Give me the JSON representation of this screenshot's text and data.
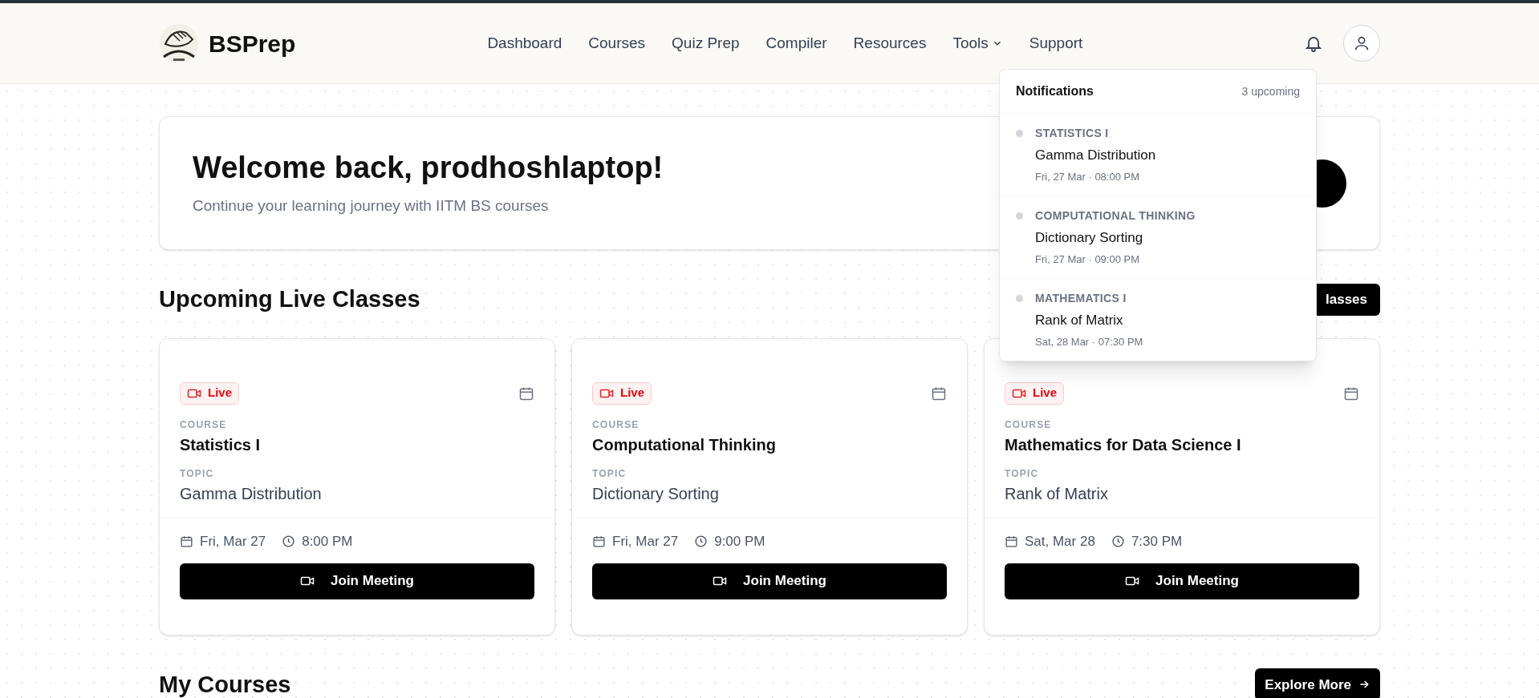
{
  "brand": {
    "name": "BSPrep"
  },
  "nav": [
    {
      "label": "Dashboard",
      "dropdown": false
    },
    {
      "label": "Courses",
      "dropdown": false
    },
    {
      "label": "Quiz Prep",
      "dropdown": false
    },
    {
      "label": "Compiler",
      "dropdown": false
    },
    {
      "label": "Resources",
      "dropdown": false
    },
    {
      "label": "Tools",
      "dropdown": true
    },
    {
      "label": "Support",
      "dropdown": false
    }
  ],
  "welcome": {
    "title": "Welcome back, prodhoshlaptop!",
    "subtitle": "Continue your learning journey with IITM BS courses"
  },
  "upcoming": {
    "title": "Upcoming Live Classes",
    "button": "lasses",
    "cards": [
      {
        "badge": "Live",
        "course_label": "COURSE",
        "course": "Statistics I",
        "topic_label": "TOPIC",
        "topic": "Gamma Distribution",
        "date": "Fri, Mar 27",
        "time": "8:00 PM",
        "button": "Join Meeting"
      },
      {
        "badge": "Live",
        "course_label": "COURSE",
        "course": "Computational Thinking",
        "topic_label": "TOPIC",
        "topic": "Dictionary Sorting",
        "date": "Fri, Mar 27",
        "time": "9:00 PM",
        "button": "Join Meeting"
      },
      {
        "badge": "Live",
        "course_label": "COURSE",
        "course": "Mathematics for Data Science I",
        "topic_label": "TOPIC",
        "topic": "Rank of Matrix",
        "date": "Sat, Mar 28",
        "time": "7:30 PM",
        "button": "Join Meeting"
      }
    ]
  },
  "my_courses": {
    "title": "My Courses",
    "button": "Explore More"
  },
  "notifications": {
    "title": "Notifications",
    "count": "3 upcoming",
    "items": [
      {
        "course": "STATISTICS I",
        "topic": "Gamma Distribution",
        "when": "Fri, 27 Mar · 08:00 PM"
      },
      {
        "course": "COMPUTATIONAL THINKING",
        "topic": "Dictionary Sorting",
        "when": "Fri, 27 Mar · 09:00 PM"
      },
      {
        "course": "MATHEMATICS I",
        "topic": "Rank of Matrix",
        "when": "Sat, 28 Mar · 07:30 PM"
      }
    ]
  }
}
